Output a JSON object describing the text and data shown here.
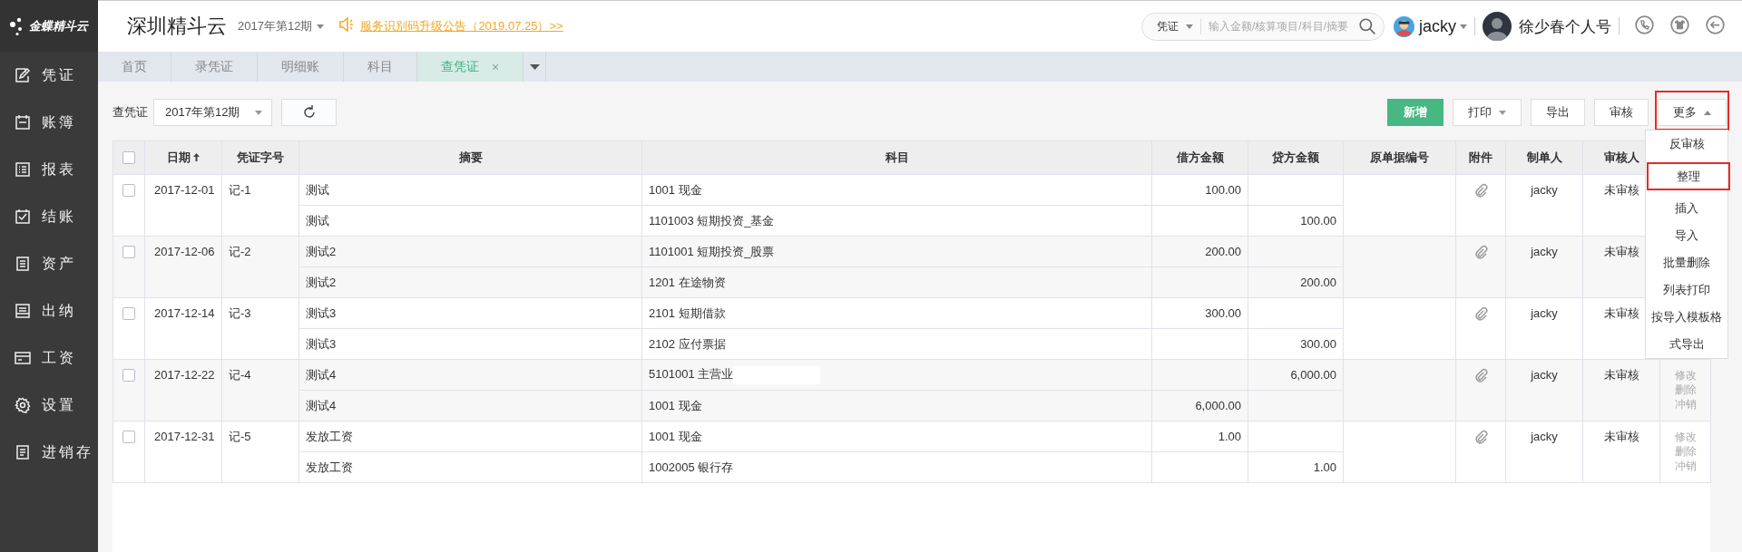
{
  "sidebar": {
    "logo": "金蝶精斗云",
    "items": [
      {
        "label": "凭证"
      },
      {
        "label": "账簿"
      },
      {
        "label": "报表"
      },
      {
        "label": "结账"
      },
      {
        "label": "资产"
      },
      {
        "label": "出纳"
      },
      {
        "label": "工资"
      },
      {
        "label": "设置"
      },
      {
        "label": "进销存"
      }
    ]
  },
  "header": {
    "company": "深圳精斗云",
    "period": "2017年第12期",
    "notice": "服务识别码升级公告（2019.07.25）>>",
    "search": {
      "scope": "凭证",
      "placeholder": "输入金额/核算项目/科目/摘要"
    },
    "user": "jacky",
    "account": "徐少春个人号"
  },
  "tabs": [
    {
      "label": "首页",
      "selected": false
    },
    {
      "label": "录凭证",
      "selected": false
    },
    {
      "label": "明细账",
      "selected": false
    },
    {
      "label": "科目",
      "selected": false
    },
    {
      "label": "查凭证",
      "selected": true,
      "close": "×"
    }
  ],
  "toolbar": {
    "label": "查凭证",
    "period": "2017年第12期",
    "buttons": [
      {
        "label": "新增",
        "kind": "primary"
      },
      {
        "label": "打印",
        "kind": "dropdown"
      },
      {
        "label": "导出",
        "kind": "plain"
      },
      {
        "label": "审核",
        "kind": "plain"
      },
      {
        "label": "更多",
        "kind": "menu",
        "expanded": true,
        "highlighted": true
      }
    ]
  },
  "menu": {
    "items": [
      {
        "label": "反审核",
        "highlighted": false
      },
      {
        "label": "整理",
        "highlighted": true
      },
      {
        "label": "插入",
        "highlighted": false
      },
      {
        "label": "导入",
        "highlighted": false
      },
      {
        "label": "批量删除",
        "highlighted": false
      },
      {
        "label": "列表打印",
        "highlighted": false
      },
      {
        "label": "按导入模板格式导出",
        "highlighted": false
      }
    ]
  },
  "table": {
    "select_all_checked": false,
    "columns": [
      {
        "label": "日期",
        "sorted": true
      },
      {
        "label": "凭证字号"
      },
      {
        "label": "摘要"
      },
      {
        "label": "科目"
      },
      {
        "label": "借方金额"
      },
      {
        "label": "贷方金额"
      },
      {
        "label": "原单据编号"
      },
      {
        "label": "附件"
      },
      {
        "label": "制单人"
      },
      {
        "label": "审核人"
      }
    ],
    "vouchers": [
      {
        "checked": false,
        "date": "2017-12-01",
        "number": "记-1",
        "attachment": true,
        "preparer": "jacky",
        "auditor": "未审核",
        "lines": [
          {
            "summary": "测试",
            "account": "1001 现金",
            "debit": "100.00"
          },
          {
            "summary": "测试",
            "account": "1101003 短期投资_基金",
            "credit": "100.00"
          }
        ]
      },
      {
        "checked": false,
        "date": "2017-12-06",
        "number": "记-2",
        "attachment": true,
        "preparer": "jacky",
        "auditor": "未审核",
        "lines": [
          {
            "summary": "测试2",
            "account": "1101001 短期投资_股票",
            "debit": "200.00"
          },
          {
            "summary": "测试2",
            "account": "1201 在途物资",
            "credit": "200.00"
          }
        ]
      },
      {
        "checked": false,
        "date": "2017-12-14",
        "number": "记-3",
        "attachment": true,
        "preparer": "jacky",
        "auditor": "未审核",
        "lines": [
          {
            "summary": "测试3",
            "account": "2101 短期借款",
            "debit": "300.00"
          },
          {
            "summary": "测试3",
            "account": "2102 应付票据",
            "credit": "300.00"
          }
        ]
      },
      {
        "checked": false,
        "date": "2017-12-22",
        "number": "记-4",
        "attachment": true,
        "preparer": "jacky",
        "auditor": "未审核",
        "actions": [
          "修改",
          "删除",
          "冲销"
        ],
        "lines": [
          {
            "summary": "测试4",
            "account": "5101001 主营业",
            "redacted": true,
            "credit": "6,000.00"
          },
          {
            "summary": "测试4",
            "account": "1001 现金",
            "debit": "6,000.00"
          }
        ]
      },
      {
        "checked": false,
        "date": "2017-12-31",
        "number": "记-5",
        "attachment": true,
        "preparer": "jacky",
        "auditor": "未审核",
        "actions": [
          "修改",
          "删除",
          "冲销"
        ],
        "lines": [
          {
            "summary": "发放工资",
            "account": "1001 现金",
            "debit": "1.00"
          },
          {
            "summary": "发放工资",
            "account": "1002005 银行存",
            "credit": "1.00"
          }
        ]
      }
    ]
  }
}
